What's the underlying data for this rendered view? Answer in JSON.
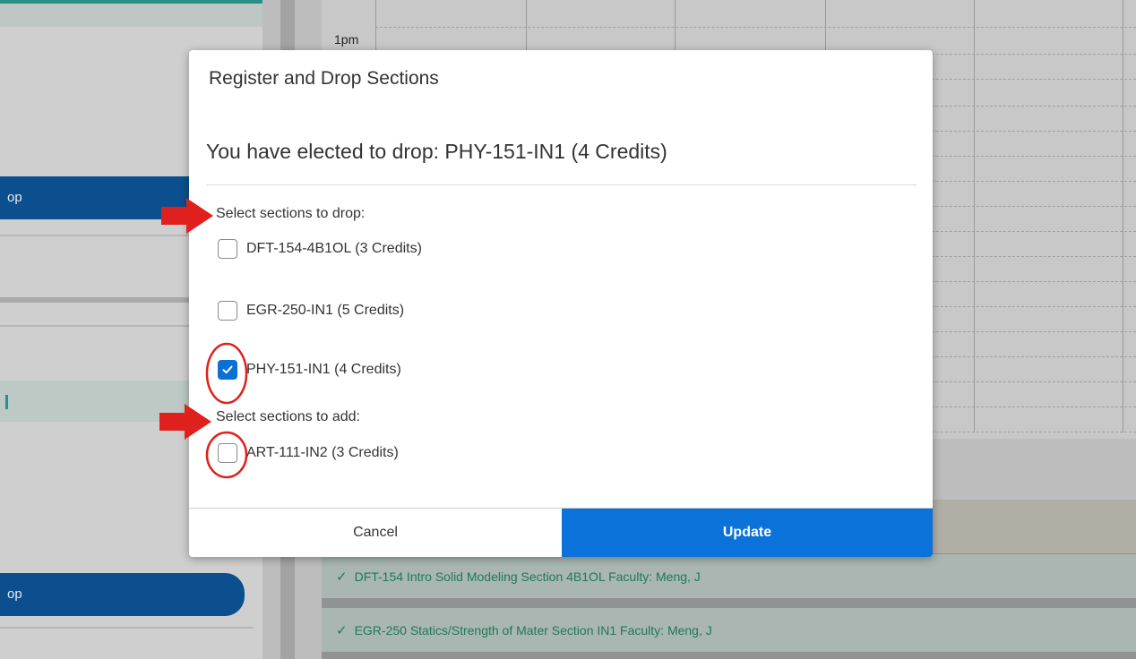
{
  "background": {
    "left_panel": {
      "blue_item_1_fragment": "op",
      "blue_item_2_fragment": "op"
    },
    "calendar": {
      "time_label": "1pm"
    },
    "course_rows": [
      "DFT-154 Intro Solid Modeling Section 4B1OL Faculty: Meng, J",
      "EGR-250 Statics/Strength of Mater Section IN1 Faculty: Meng, J"
    ]
  },
  "modal": {
    "title": "Register and Drop Sections",
    "message": "You have elected to drop: PHY-151-IN1 (4 Credits)",
    "drop_label": "Select sections to drop:",
    "drop_options": [
      {
        "label": "DFT-154-4B1OL (3 Credits)",
        "checked": false
      },
      {
        "label": "EGR-250-IN1 (5 Credits)",
        "checked": false
      },
      {
        "label": "PHY-151-IN1 (4 Credits)",
        "checked": true
      }
    ],
    "add_label": "Select sections to add:",
    "add_options": [
      {
        "label": "ART-111-IN2 (3 Credits)",
        "checked": false
      }
    ],
    "cancel_label": "Cancel",
    "update_label": "Update"
  },
  "colors": {
    "primary": "#0b72d9",
    "annotation_red": "#e0201c",
    "success_green": "#1f7a57"
  },
  "icons": {
    "checkbox_check": "checkmark-icon",
    "course_status": "check-icon",
    "annotation": "red-arrow-icon"
  }
}
